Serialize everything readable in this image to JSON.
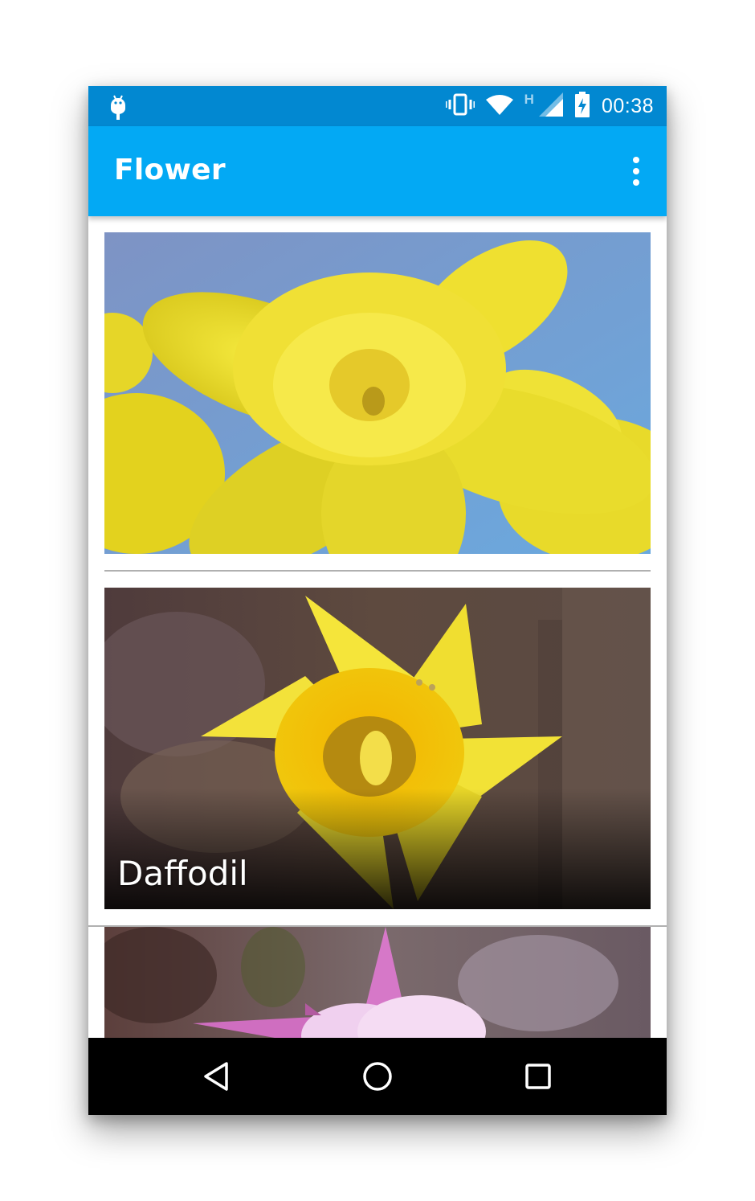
{
  "status_bar": {
    "time": "00:38",
    "network_label": "H",
    "icons": [
      "android-debug-icon",
      "vibrate-icon",
      "wifi-icon",
      "cell-signal-icon",
      "battery-charging-icon"
    ]
  },
  "app_bar": {
    "title": "Flower",
    "overflow_icon": "more-vert-icon"
  },
  "flowers": [
    {
      "caption": ""
    },
    {
      "caption": "Daffodil"
    },
    {
      "caption": ""
    }
  ],
  "nav_bar": {
    "buttons": [
      "back-icon",
      "home-icon",
      "recents-icon"
    ]
  },
  "colors": {
    "status_bar": "#0288d1",
    "app_bar": "#03a9f4",
    "nav_bar": "#000000"
  }
}
